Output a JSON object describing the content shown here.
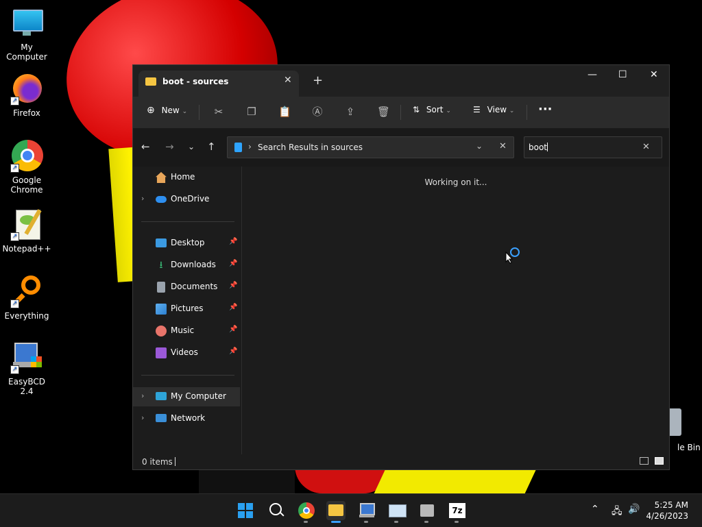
{
  "desktop": {
    "icons": [
      {
        "label": "My Computer"
      },
      {
        "label": "Firefox"
      },
      {
        "label": "Google Chrome"
      },
      {
        "label": "Notepad++"
      },
      {
        "label": "Everything"
      },
      {
        "label": "EasyBCD 2.4"
      }
    ],
    "recycle_bin_partial": "le Bin"
  },
  "window": {
    "tab_title": "boot - sources",
    "new_tab": "+",
    "controls": {
      "minimize": "—",
      "maximize": "☐",
      "close": "✕"
    },
    "toolbar": {
      "new_label": "New",
      "sort_label": "Sort",
      "view_label": "View",
      "more": "···"
    },
    "address": {
      "path": "Search Results in sources"
    },
    "search": {
      "value": "boot"
    },
    "nav": {
      "items": [
        {
          "label": "Home"
        },
        {
          "label": "OneDrive"
        },
        {
          "label": "Desktop"
        },
        {
          "label": "Downloads"
        },
        {
          "label": "Documents"
        },
        {
          "label": "Pictures"
        },
        {
          "label": "Music"
        },
        {
          "label": "Videos"
        },
        {
          "label": "My Computer"
        },
        {
          "label": "Network"
        }
      ]
    },
    "content": {
      "status_message": "Working on it..."
    },
    "statusbar": {
      "items_count": "0 items"
    }
  },
  "taskbar": {
    "clock": {
      "time": "5:25 AM",
      "date": "4/26/2023"
    },
    "apps": [
      "start",
      "search",
      "chrome",
      "file-explorer",
      "easybcd",
      "resource-monitor",
      "app-installer",
      "7zip"
    ]
  },
  "colors": {
    "accent": "#3aa0ff",
    "window_bg": "#1c1c1c",
    "toolbar_bg": "#2b2b2b"
  }
}
